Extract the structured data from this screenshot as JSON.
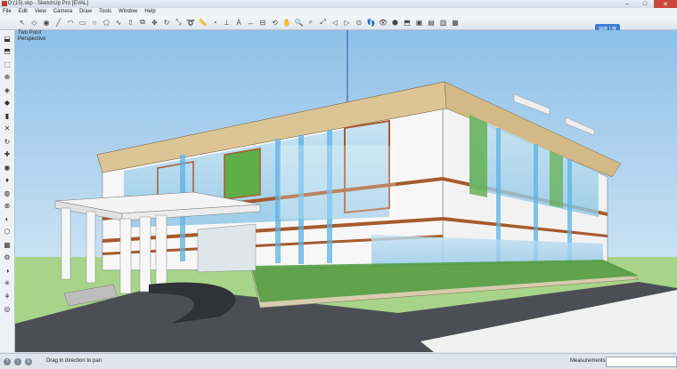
{
  "window": {
    "title": "D:(15).skp - SketchUp Pro [EVAL]",
    "minimize": "–",
    "maximize": "□",
    "close": "✕"
  },
  "menu": [
    "File",
    "Edit",
    "View",
    "Camera",
    "Draw",
    "Tools",
    "Window",
    "Help"
  ],
  "toolbar": {
    "icons": [
      "select-icon",
      "eraser-icon",
      "paint-bucket-icon",
      "line-icon",
      "arc-icon",
      "rectangle-icon",
      "circle-icon",
      "polygon-icon",
      "freehand-icon",
      "push-pull-icon",
      "offset-icon",
      "move-icon",
      "rotate-icon",
      "scale-icon",
      "follow-me-icon",
      "tape-measure-icon",
      "protractor-icon",
      "axes-icon",
      "text-icon",
      "dimension-icon",
      "section-plane-icon",
      "orbit-icon",
      "pan-icon",
      "zoom-icon",
      "zoom-window-icon",
      "zoom-extents-icon",
      "previous-view-icon",
      "next-view-icon",
      "position-camera-icon",
      "walk-icon",
      "look-around-icon",
      "iso-view-icon",
      "top-view-icon",
      "front-view-icon",
      "right-view-icon",
      "back-view-icon",
      "left-view-icon"
    ],
    "glyphs": [
      "↖",
      "◇",
      "◉",
      "╱",
      "◠",
      "▭",
      "○",
      "⬠",
      "∿",
      "⇧",
      "⧉",
      "✥",
      "↻",
      "⤡",
      "➰",
      "📏",
      "◔",
      "⊥",
      "A",
      "↔",
      "⊟",
      "⟲",
      "✋",
      "🔍",
      "⌕",
      "⤢",
      "◁",
      "▷",
      "⊙",
      "👣",
      "👁",
      "⬢",
      "⬒",
      "▣",
      "▤",
      "▥",
      "▦"
    ],
    "upload_label": "拟南上传"
  },
  "left_toolbar": {
    "icons": [
      "tool-1-icon",
      "tool-2-icon",
      "tool-3-icon",
      "tool-4-icon",
      "tool-5-icon",
      "tool-6-icon",
      "tool-7-icon",
      "tool-8-icon",
      "tool-9-icon",
      "tool-10-icon",
      "tool-11-icon",
      "tool-12-icon",
      "tool-13-icon",
      "tool-14-icon",
      "tool-15-icon",
      "tool-16-icon",
      "tool-17-icon",
      "tool-18-icon",
      "tool-19-icon",
      "tool-20-icon",
      "tool-21-icon",
      "tool-22-icon"
    ],
    "glyphs": [
      "⬓",
      "⬒",
      "⬚",
      "⊕",
      "◈",
      "◆",
      "▮",
      "✕",
      "↻",
      "✚",
      "◉",
      "♦",
      "◍",
      "⊗",
      "◐",
      "⬡",
      "▦",
      "⚙",
      "◑",
      "✳",
      "⚘",
      "◎"
    ]
  },
  "viewport": {
    "label_line1": "Two Point",
    "label_line2": "Perspective"
  },
  "status": {
    "hint": "Drag in direction to pan",
    "icon_glyphs": [
      "?",
      "i",
      "©"
    ],
    "measurements_label": "Measurements",
    "measurements_value": ""
  }
}
